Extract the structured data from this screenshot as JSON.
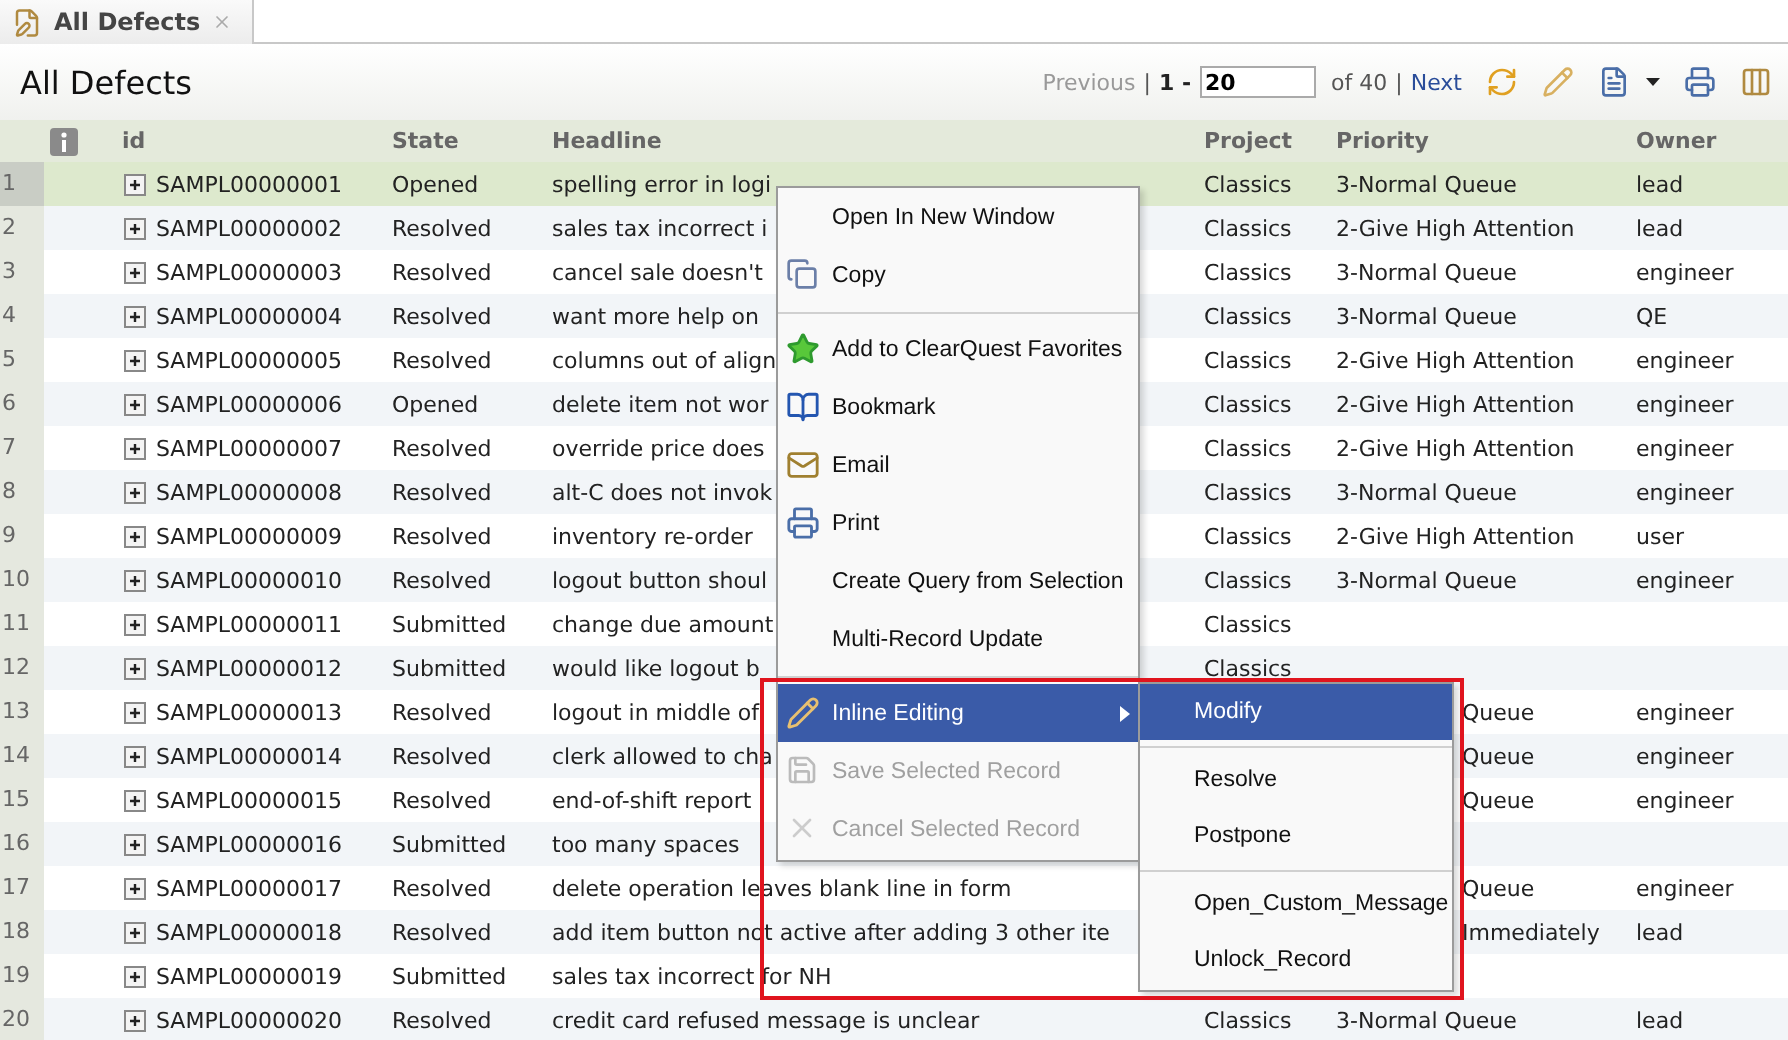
{
  "tab": {
    "label": "All Defects",
    "selected": true
  },
  "title": "All Defects",
  "pager": {
    "previous": "Previous",
    "separator_1": "|",
    "range_start": "1 -",
    "page_size": "20",
    "total": "of 40",
    "separator_2": "|",
    "next": "Next",
    "previous_disabled": true
  },
  "table": {
    "columns": [
      "id",
      "State",
      "Headline",
      "Project",
      "Priority",
      "Owner"
    ],
    "rows": [
      {
        "num": "1",
        "id": "SAMPL00000001",
        "state": "Opened",
        "headline": "spelling error in logi",
        "project": "Classics",
        "priority": "3-Normal Queue",
        "owner": "lead",
        "selected": true
      },
      {
        "num": "2",
        "id": "SAMPL00000002",
        "state": "Resolved",
        "headline": "sales tax incorrect i",
        "project": "Classics",
        "priority": "2-Give High Attention",
        "owner": "lead",
        "selected": false
      },
      {
        "num": "3",
        "id": "SAMPL00000003",
        "state": "Resolved",
        "headline": "cancel sale doesn't",
        "project": "Classics",
        "priority": "3-Normal Queue",
        "owner": "engineer",
        "selected": false
      },
      {
        "num": "4",
        "id": "SAMPL00000004",
        "state": "Resolved",
        "headline": "want more help on",
        "project": "Classics",
        "priority": "3-Normal Queue",
        "owner": "QE",
        "selected": false
      },
      {
        "num": "5",
        "id": "SAMPL00000005",
        "state": "Resolved",
        "headline": "columns out of align",
        "project": "Classics",
        "priority": "2-Give High Attention",
        "owner": "engineer",
        "selected": false
      },
      {
        "num": "6",
        "id": "SAMPL00000006",
        "state": "Opened",
        "headline": "delete item not wor",
        "project": "Classics",
        "priority": "2-Give High Attention",
        "owner": "engineer",
        "selected": false
      },
      {
        "num": "7",
        "id": "SAMPL00000007",
        "state": "Resolved",
        "headline": "override price does",
        "project": "Classics",
        "priority": "2-Give High Attention",
        "owner": "engineer",
        "selected": false
      },
      {
        "num": "8",
        "id": "SAMPL00000008",
        "state": "Resolved",
        "headline": "alt-C does not invok",
        "project": "Classics",
        "priority": "3-Normal Queue",
        "owner": "engineer",
        "selected": false
      },
      {
        "num": "9",
        "id": "SAMPL00000009",
        "state": "Resolved",
        "headline": "inventory re-order",
        "project": "Classics",
        "priority": "2-Give High Attention",
        "owner": "user",
        "selected": false
      },
      {
        "num": "10",
        "id": "SAMPL00000010",
        "state": "Resolved",
        "headline": "logout button shoul",
        "project": "Classics",
        "priority": "3-Normal Queue",
        "owner": "engineer",
        "selected": false
      },
      {
        "num": "11",
        "id": "SAMPL00000011",
        "state": "Submitted",
        "headline": "change due amount",
        "project": "Classics",
        "selected": false
      },
      {
        "num": "12",
        "id": "SAMPL00000012",
        "state": "Submitted",
        "headline": "would like logout b",
        "project": "Classics",
        "selected": false
      },
      {
        "num": "13",
        "id": "SAMPL00000013",
        "state": "Resolved",
        "headline": "logout in middle of",
        "priority": "Queue",
        "priority_covered": true,
        "owner": "engineer",
        "selected": false
      },
      {
        "num": "14",
        "id": "SAMPL00000014",
        "state": "Resolved",
        "headline": "clerk allowed to cha",
        "priority": "Queue",
        "priority_covered": true,
        "owner": "engineer",
        "selected": false
      },
      {
        "num": "15",
        "id": "SAMPL00000015",
        "state": "Resolved",
        "headline": "end-of-shift report",
        "priority": "Queue",
        "priority_covered": true,
        "owner": "engineer",
        "selected": false
      },
      {
        "num": "16",
        "id": "SAMPL00000016",
        "state": "Submitted",
        "headline": "too many spaces",
        "selected": false
      },
      {
        "num": "17",
        "id": "SAMPL00000017",
        "state": "Resolved",
        "headline": "delete operation leaves blank line in form",
        "priority": "Queue",
        "priority_covered": true,
        "owner": "engineer",
        "selected": false
      },
      {
        "num": "18",
        "id": "SAMPL00000018",
        "state": "Resolved",
        "headline": "add item button not active after adding 3 other ite",
        "priority": "Immediately",
        "priority_covered": true,
        "owner": "lead",
        "selected": false
      },
      {
        "num": "19",
        "id": "SAMPL00000019",
        "state": "Submitted",
        "headline": "sales tax incorrect for NH",
        "selected": false
      },
      {
        "num": "20",
        "id": "SAMPL00000020",
        "state": "Resolved",
        "headline": "credit card refused message is unclear",
        "project": "Classics",
        "priority": "3-Normal Queue",
        "owner": "lead",
        "selected": false
      }
    ]
  },
  "context_menu": {
    "items": [
      {
        "kind": "item",
        "label": "Open In New Window",
        "selected": false,
        "disabled": false
      },
      {
        "kind": "item",
        "label": "Copy",
        "selected": false,
        "disabled": false
      },
      {
        "kind": "separator"
      },
      {
        "kind": "item",
        "label": "Add to ClearQuest Favorites",
        "selected": false,
        "disabled": false
      },
      {
        "kind": "item",
        "label": "Bookmark",
        "selected": false,
        "disabled": false
      },
      {
        "kind": "item",
        "label": "Email",
        "selected": false,
        "disabled": false
      },
      {
        "kind": "item",
        "label": "Print",
        "selected": false,
        "disabled": false
      },
      {
        "kind": "item",
        "label": "Create Query from Selection",
        "selected": false,
        "disabled": false
      },
      {
        "kind": "item",
        "label": "Multi-Record Update",
        "selected": false,
        "disabled": false
      },
      {
        "kind": "separator"
      },
      {
        "kind": "item",
        "label": "Inline Editing",
        "selected": true,
        "disabled": false,
        "has_submenu": true
      },
      {
        "kind": "item",
        "label": "Save Selected Record",
        "selected": false,
        "disabled": true
      },
      {
        "kind": "item",
        "label": "Cancel Selected Record",
        "selected": false,
        "disabled": true
      }
    ]
  },
  "submenu": {
    "items": [
      {
        "kind": "item",
        "label": "Modify",
        "selected": true
      },
      {
        "kind": "separator"
      },
      {
        "kind": "item",
        "label": "Resolve",
        "selected": false
      },
      {
        "kind": "item",
        "label": "Postpone",
        "selected": false
      },
      {
        "kind": "separator"
      },
      {
        "kind": "item",
        "label": "Open_Custom_Message",
        "selected": false
      },
      {
        "kind": "item",
        "label": "Unlock_Record",
        "selected": false
      }
    ]
  },
  "highlight_frame": {
    "color": "#e0141e"
  }
}
